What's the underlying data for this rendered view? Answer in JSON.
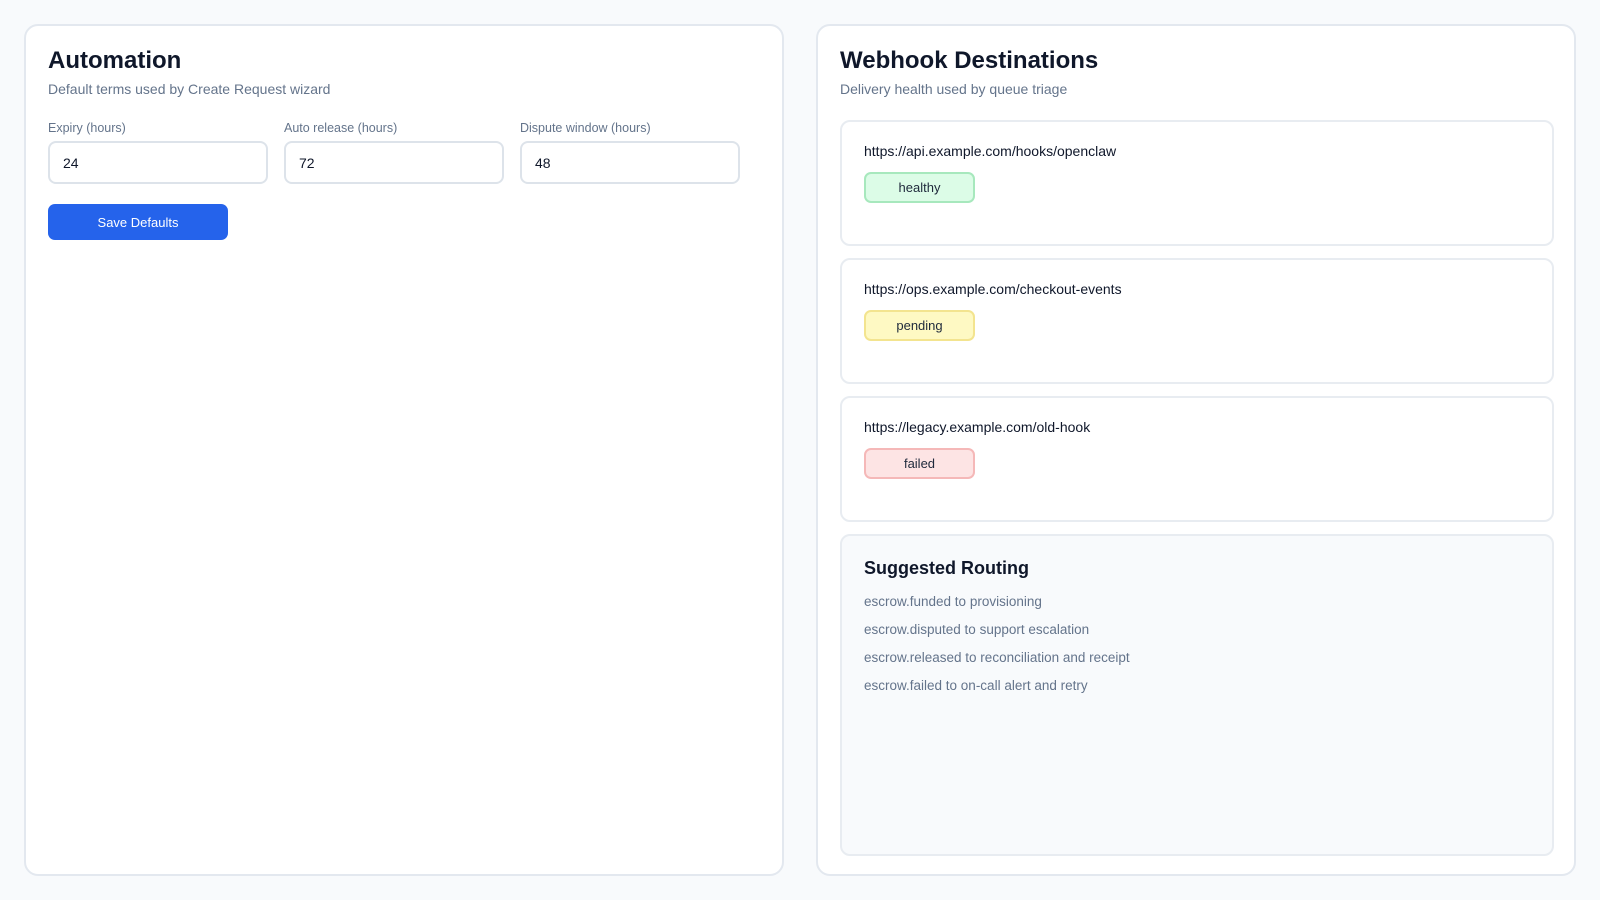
{
  "automation": {
    "title": "Automation",
    "subtitle": "Default terms used by Create Request wizard",
    "fields": [
      {
        "label": "Expiry (hours)",
        "value": "24"
      },
      {
        "label": "Auto release (hours)",
        "value": "72"
      },
      {
        "label": "Dispute window (hours)",
        "value": "48"
      }
    ],
    "save_label": "Save Defaults"
  },
  "webhooks": {
    "title": "Webhook Destinations",
    "subtitle": "Delivery health used by queue triage",
    "items": [
      {
        "url": "https://api.example.com/hooks/openclaw",
        "status": "healthy"
      },
      {
        "url": "https://ops.example.com/checkout-events",
        "status": "pending"
      },
      {
        "url": "https://legacy.example.com/old-hook",
        "status": "failed"
      }
    ],
    "routing": {
      "title": "Suggested Routing",
      "items": [
        "escrow.funded to provisioning",
        "escrow.disputed to support escalation",
        "escrow.released to reconciliation and receipt",
        "escrow.failed to on-call alert and retry"
      ]
    }
  },
  "colors": {
    "primary": "#2563eb",
    "healthy": "#dcfce7",
    "pending": "#fef9c3",
    "failed": "#fde4e4"
  }
}
